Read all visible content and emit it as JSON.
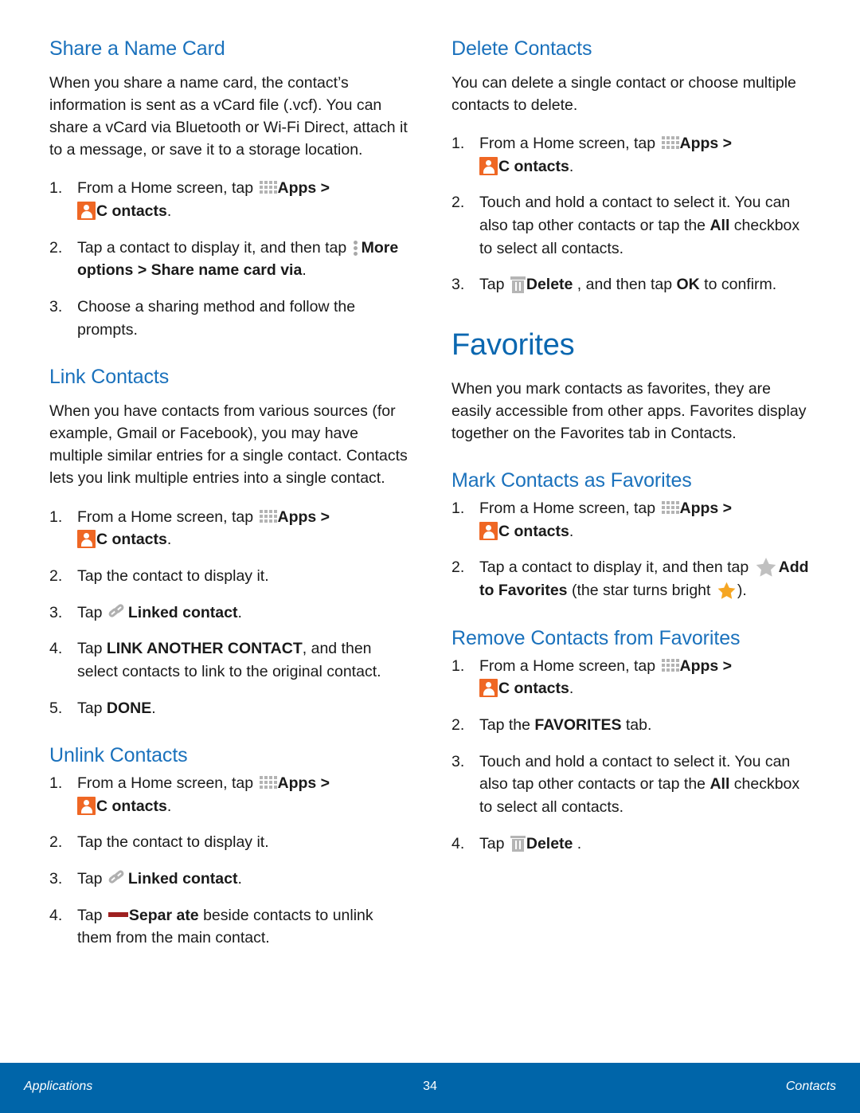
{
  "page": {
    "number": "34",
    "footer_left": "Applications",
    "footer_right": "Contacts",
    "accent_blue": "#1a71bc",
    "chapter_blue": "#0a67b0",
    "footer_blue": "#0065a9",
    "contacts_icon_orange": "#ef6724",
    "star_orange": "#f5a623",
    "separate_red": "#9e2020"
  },
  "left_column": {
    "sections": [
      {
        "heading": "Share a Name Card",
        "paragraph": "When you share a name card, the contact’s information is sent as a vCard file (.vcf). You can share a vCard via Bluetooth or Wi-Fi Direct, attach it to a message, or save it to a storage location.",
        "steps": {
          "s1_num": "1.",
          "s1_a": "From a Home screen, tap ",
          "s1_b": "Apps > ",
          "s1_c": "C ontacts",
          "s1_d": ".",
          "s2_num": "2.",
          "s2_a": "Tap a contact to display it, and then tap ",
          "s2_b": "More options > Share name card via",
          "s2_c": ".",
          "s3_num": "3.",
          "s3_a": "Choose a sharing method and follow the prompts."
        }
      },
      {
        "heading": "Link Contacts",
        "paragraph": "When you have contacts from various sources (for example, Gmail or Facebook), you may have multiple similar entries for a single contact. Contacts lets you link multiple entries into a single contact.",
        "steps": {
          "s1_num": "1.",
          "s1_a": "From a Home screen, tap ",
          "s1_b": "Apps > ",
          "s1_c": "C ontacts",
          "s1_d": ".",
          "s2_num": "2.",
          "s2_a": "Tap the contact to display it.",
          "s3_num": "3.",
          "s3_a": "Tap ",
          "s3_b": "Linked contact",
          "s3_c": ".",
          "s4_num": "4.",
          "s4_a": "Tap ",
          "s4_b": "LINK ANOTHER CONTACT",
          "s4_c": ", and then select contacts to link to the original contact.",
          "s5_num": "5.",
          "s5_a": "Tap ",
          "s5_b": "DONE",
          "s5_c": "."
        }
      },
      {
        "heading": "Unlink Contacts",
        "steps": {
          "s1_num": "1.",
          "s1_a": "From a Home screen, tap ",
          "s1_b": "Apps > ",
          "s1_c": "C ontacts",
          "s1_d": ".",
          "s2_num": "2.",
          "s2_a": "Tap the contact to display it.",
          "s3_num": "3.",
          "s3_a": "Tap ",
          "s3_b": "Linked contact",
          "s3_c": ".",
          "s4_num": "4.",
          "s4_a": "Tap ",
          "s4_b": "Separ ate",
          "s4_c": " beside contacts to unlink them from the main contact."
        }
      }
    ]
  },
  "right_column": {
    "delete_contacts": {
      "heading": "Delete Contacts",
      "paragraph": "You can delete a single contact or choose multiple contacts to delete.",
      "steps": {
        "s1_num": "1.",
        "s1_a": "From a Home screen, tap ",
        "s1_b": "Apps > ",
        "s1_c": "C ontacts",
        "s1_d": ".",
        "s2_num": "2.",
        "s2_a": "Touch and hold a contact to select it. You can also tap other contacts or tap the ",
        "s2_b": "All",
        "s2_c": " checkbox to select all contacts.",
        "s3_num": "3.",
        "s3_a": "Tap ",
        "s3_b": "Delete",
        "s3_c": " , and then tap ",
        "s3_d": "OK",
        "s3_e": " to confirm."
      }
    },
    "favorites": {
      "heading": "Favorites",
      "paragraph": "When you mark contacts as favorites, they are easily accessible from other apps. Favorites display together on the Favorites tab in Contacts."
    },
    "mark_favorites": {
      "heading": "Mark Contacts as Favorites",
      "steps": {
        "s1_num": "1.",
        "s1_a": "From a Home screen, tap ",
        "s1_b": "Apps > ",
        "s1_c": "C ontacts",
        "s1_d": ".",
        "s2_num": "2.",
        "s2_a": "Tap a contact to display it, and then tap ",
        "s2_b": "Add to Favorites",
        "s2_c": " (the star turns bright ",
        "s2_d": ")."
      }
    },
    "remove_favorites": {
      "heading": "Remove Contacts from Favorites",
      "steps": {
        "s1_num": "1.",
        "s1_a": "From a Home screen, tap ",
        "s1_b": "Apps > ",
        "s1_c": "C ontacts",
        "s1_d": ".",
        "s2_num": "2.",
        "s2_a": "Tap the ",
        "s2_b": "FAVORITES",
        "s2_c": " tab.",
        "s3_num": "3.",
        "s3_a": "Touch and hold a contact to select it. You can also tap other contacts or tap the ",
        "s3_b": "All",
        "s3_c": " checkbox to select all contacts.",
        "s4_num": "4.",
        "s4_a": "Tap ",
        "s4_b": "Delete",
        "s4_c": " ."
      }
    }
  }
}
